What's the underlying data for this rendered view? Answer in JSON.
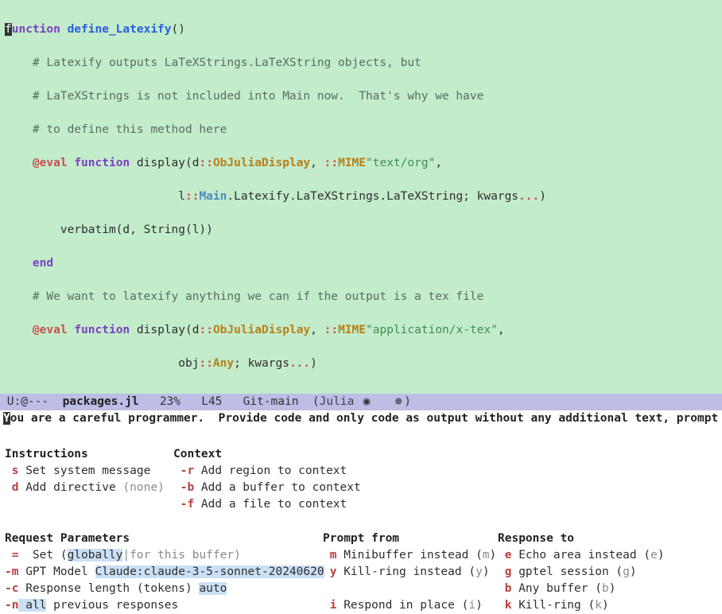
{
  "code": {
    "l1_kw": "function",
    "l1_name": " define_Latexify",
    "l1_rest": "()",
    "l2": "    # Latexify outputs LaTeXStrings.LaTeXString objects, but",
    "l3": "    # LaTeXStrings is not included into Main now.  That's why we have",
    "l4": "    # to define this method here",
    "l5_indent": "    ",
    "l5_macro": "@eval",
    "l5_sp": " ",
    "l5_kw": "function",
    "l5_a": " display(d",
    "l5_op1": "::",
    "l5_type1": "ObJuliaDisplay",
    "l5_b": ", ",
    "l5_op2": "::",
    "l5_type2": "MIME",
    "l5_str": "\"text/org\"",
    "l5_end": ",",
    "l6_indent": "                         l",
    "l6_op": "::",
    "l6_main": "Main",
    "l6_rest": ".Latexify.LaTeXStrings.LaTeXString; kwargs",
    "l6_dots": "...",
    "l6_end": ")",
    "l7": "        verbatim(d, String(l))",
    "l8_indent": "    ",
    "l8_kw": "end",
    "l9": "    # We want to latexify anything we can if the output is a tex file",
    "l10_indent": "    ",
    "l10_macro": "@eval",
    "l10_sp": " ",
    "l10_kw": "function",
    "l10_a": " display(d",
    "l10_op1": "::",
    "l10_type1": "ObJuliaDisplay",
    "l10_b": ", ",
    "l10_op2": "::",
    "l10_type2": "MIME",
    "l10_str": "\"application/x-tex\"",
    "l10_end": ",",
    "l11_indent": "                         obj",
    "l11_op": "::",
    "l11_type": "Any",
    "l11_rest": "; kwargs",
    "l11_dots": "...",
    "l11_end": ")"
  },
  "modeline": {
    "prefix": " U:@--- ",
    "file": " packages.jl",
    "gap1": "   ",
    "pct": "23%",
    "gap2": "   ",
    "line": "L45",
    "gap3": "   ",
    "vc": "Git-main",
    "gap4": "  (",
    "lang": "Julia",
    "icon1": "◉",
    "icon2": "⊛",
    "tail": ")"
  },
  "minibuf": {
    "first": "Y",
    "rest": "ou are a careful programmer.  Provide code and only code as output without any additional text, prompt ..."
  },
  "help": {
    "instructions_heading": "Instructions",
    "context_heading": "Context",
    "instr": {
      "s_key": "s",
      "s_text": " Set system message",
      "d_key": "d",
      "d_text": " Add directive ",
      "d_none": "(none)"
    },
    "ctx": {
      "r_key": "-r",
      "r_text": " Add region to context",
      "b_key": "-b",
      "b_text": " Add a buffer to context",
      "f_key": "-f",
      "f_text": " Add a file to context"
    },
    "req_heading": "Request Parameters",
    "req": {
      "eq_key": " =",
      "eq_a": "  Set (",
      "eq_hl": "globally",
      "eq_b": "|for this buffer)",
      "m_key": "-m",
      "m_a": " GPT Model ",
      "m_hl": "Claude:claude-3-5-sonnet-20240620",
      "c_key": "-c",
      "c_a": " Response length (tokens) ",
      "c_hl": "auto",
      "n_key": "-n",
      "n_hl": " all",
      "n_a": " previous responses"
    },
    "prompt_heading": "Prompt from",
    "prompt": {
      "m_key": "m",
      "m_text": " Minibuffer instead (",
      "m_sfx": "m",
      "m_end": ")",
      "y_key": "y",
      "y_text": " Kill-ring instead (",
      "y_sfx": "y",
      "y_end": ")",
      "i_key": "i",
      "i_text": " Respond in place (",
      "i_sfx": "i",
      "i_end": ")"
    },
    "resp_heading": "Response to",
    "resp": {
      "e_key": "e",
      "e_text": " Echo area instead (",
      "e_sfx": "e",
      "e_end": ")",
      "g_key": "g",
      "g_text": " gptel session (",
      "g_sfx": "g",
      "g_end": ")",
      "b_key": "b",
      "b_text": " Any buffer (",
      "b_sfx": "b",
      "b_end": ")",
      "k_key": "k",
      "k_text": " Kill-ring (",
      "k_sfx": "k",
      "k_end": ")"
    }
  }
}
